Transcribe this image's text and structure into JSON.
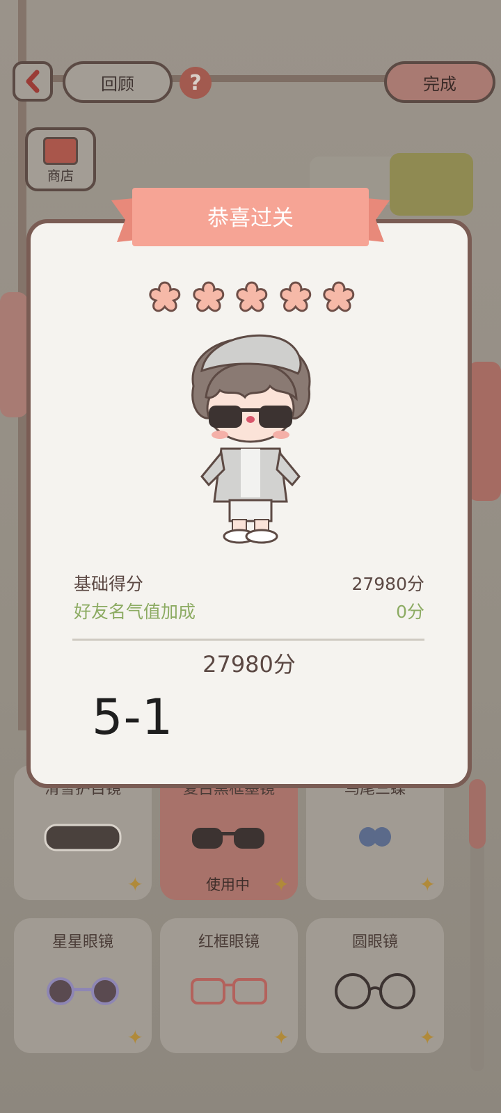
{
  "top_bar": {
    "back_icon": "chevron-left-icon",
    "review_label": "回顾",
    "help_label": "?",
    "done_label": "完成"
  },
  "shop": {
    "label": "商店"
  },
  "modal": {
    "title": "恭喜过关",
    "stars_filled": 5,
    "stars_total": 5,
    "base_score_label": "基础得分",
    "base_score_value": "27980分",
    "bonus_label": "好友名气值加成",
    "bonus_value": "0分",
    "total_value": "27980分",
    "level_text": "5-1"
  },
  "items": [
    {
      "name": "滑雪护目镜",
      "status": ""
    },
    {
      "name": "复古黑框墨镜",
      "status": "使用中"
    },
    {
      "name": "鸟尾三蝶",
      "status": ""
    },
    {
      "name": "星星眼镜",
      "status": ""
    },
    {
      "name": "红框眼镜",
      "status": ""
    },
    {
      "name": "圆眼镜",
      "status": ""
    }
  ],
  "colors": {
    "ribbon": "#f6a495",
    "accent_green": "#8cab62",
    "flower": "#f6b9a8",
    "border": "#7a5c54"
  }
}
